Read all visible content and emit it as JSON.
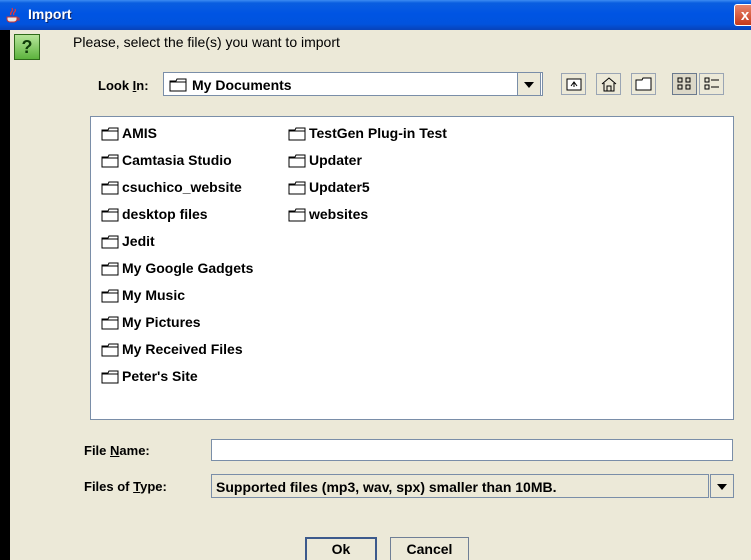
{
  "window": {
    "title": "Import",
    "close_glyph": "x"
  },
  "dialog": {
    "question_glyph": "?",
    "prompt": "Please, select the file(s) you want to import",
    "look_in_label_prefix": "Look ",
    "look_in_label_mnemonic": "I",
    "look_in_label_suffix": "n:",
    "look_in_value": "My Documents"
  },
  "toolbar": {
    "buttons": [
      "up-one-level-icon",
      "home-icon",
      "new-folder-icon",
      "list-view-icon",
      "details-view-icon"
    ]
  },
  "files": {
    "column1": [
      "AMIS",
      "Camtasia Studio",
      "csuchico_website",
      "desktop files",
      "Jedit",
      "My Google Gadgets",
      "My Music",
      "My Pictures",
      "My Received Files",
      "Peter's Site"
    ],
    "column2": [
      "TestGen Plug-in Test",
      "Updater",
      "Updater5",
      "websites"
    ]
  },
  "form": {
    "file_name_prefix": "File ",
    "file_name_mnemonic": "N",
    "file_name_suffix": "ame:",
    "file_name_value": "",
    "files_type_prefix": "Files of ",
    "files_type_mnemonic": "T",
    "files_type_suffix": "ype:",
    "files_type_value": "Supported files (mp3, wav, spx) smaller than 10MB."
  },
  "buttons": {
    "ok": "Ok",
    "cancel": "Cancel"
  },
  "colors": {
    "titlebar": "#0054e3",
    "background": "#ece9d8",
    "accent_icon": "#5cb33d"
  }
}
